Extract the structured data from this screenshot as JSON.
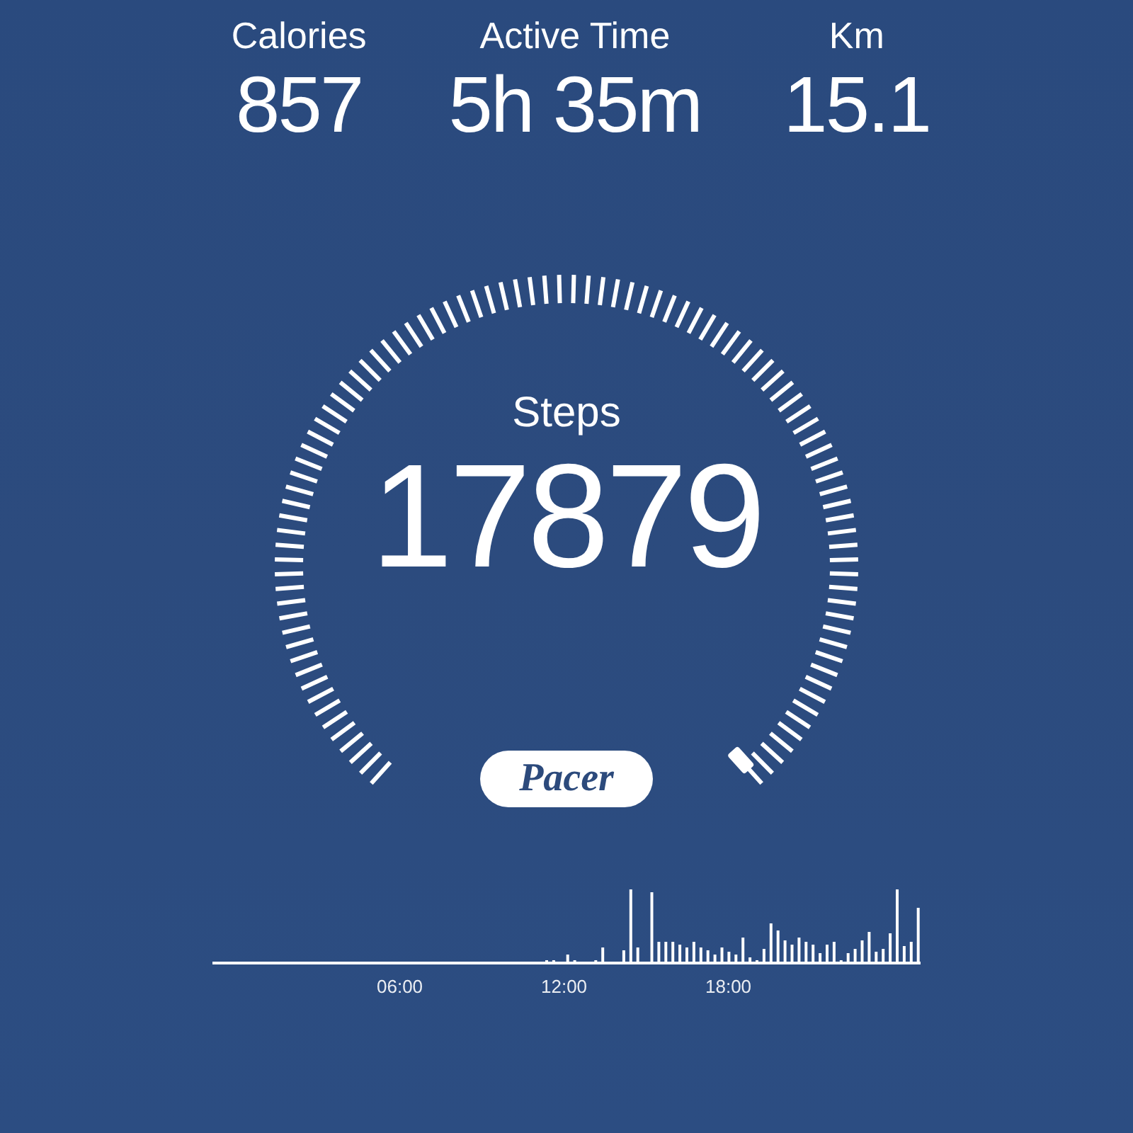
{
  "stats": [
    {
      "label": "Calories",
      "value": "857"
    },
    {
      "label": "Active Time",
      "value": "5h 35m"
    },
    {
      "label": "Km",
      "value": "15.1"
    }
  ],
  "gauge": {
    "label": "Steps",
    "value": "17879"
  },
  "brand": "Pacer",
  "activity_chart": {
    "x_labels": [
      "06:00",
      "12:00",
      "18:00"
    ]
  }
}
